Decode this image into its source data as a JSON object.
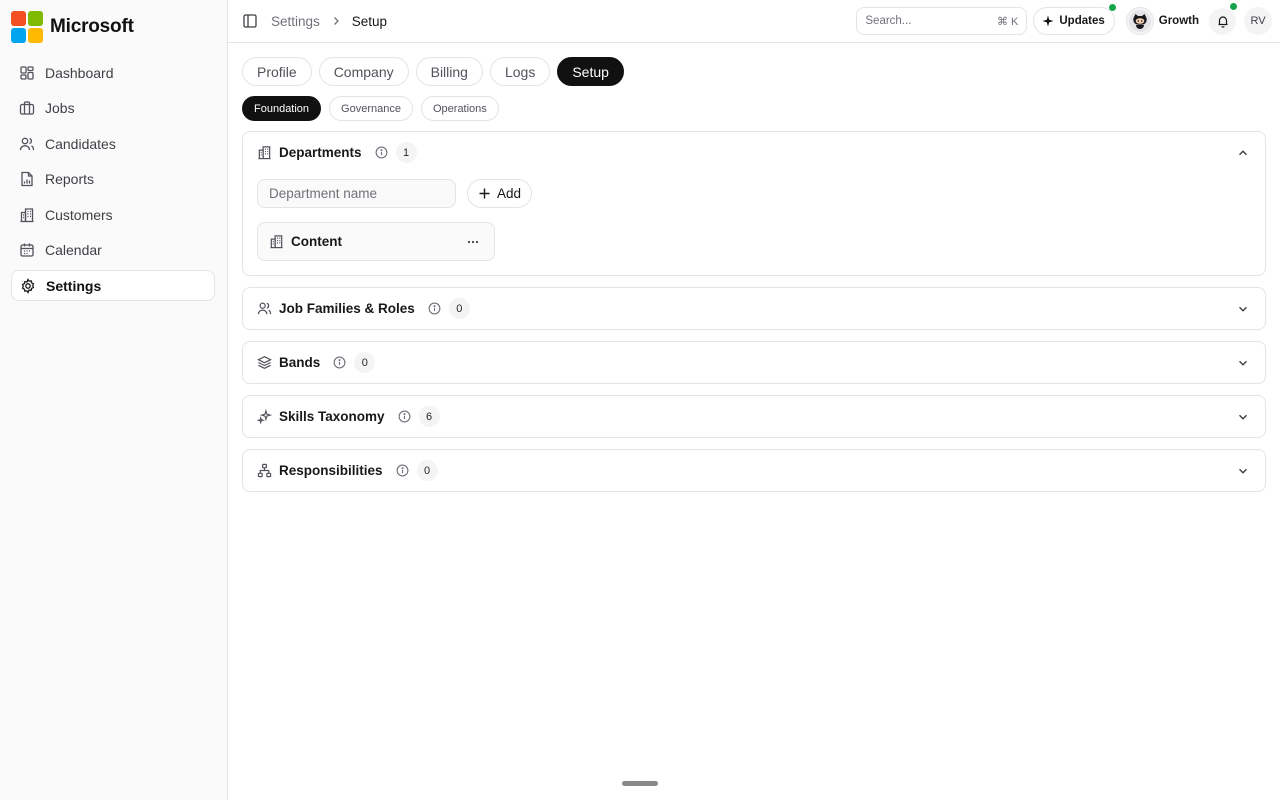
{
  "brand": {
    "name": "Microsoft",
    "logo_colors": [
      "#f25022",
      "#7fba00",
      "#00a4ef",
      "#ffb900"
    ]
  },
  "sidebar": {
    "items": [
      {
        "label": "Dashboard",
        "icon": "dashboard-icon",
        "active": false
      },
      {
        "label": "Jobs",
        "icon": "briefcase-icon",
        "active": false
      },
      {
        "label": "Candidates",
        "icon": "users-icon",
        "active": false
      },
      {
        "label": "Reports",
        "icon": "report-icon",
        "active": false
      },
      {
        "label": "Customers",
        "icon": "building-icon",
        "active": false
      },
      {
        "label": "Calendar",
        "icon": "calendar-icon",
        "active": false
      },
      {
        "label": "Settings",
        "icon": "gear-icon",
        "active": true
      }
    ]
  },
  "topbar": {
    "breadcrumb": [
      "Settings",
      "Setup"
    ],
    "search": {
      "placeholder": "Search...",
      "shortcut": "⌘ K"
    },
    "updates_label": "Updates",
    "workspace_label": "Growth",
    "user_initials": "RV",
    "status_color": "#16a34a"
  },
  "tabs": [
    {
      "label": "Profile",
      "active": false
    },
    {
      "label": "Company",
      "active": false
    },
    {
      "label": "Billing",
      "active": false
    },
    {
      "label": "Logs",
      "active": false
    },
    {
      "label": "Setup",
      "active": true
    }
  ],
  "subtabs": [
    {
      "label": "Foundation",
      "active": true
    },
    {
      "label": "Governance",
      "active": false
    },
    {
      "label": "Operations",
      "active": false
    }
  ],
  "sections": [
    {
      "title": "Departments",
      "count": "1",
      "expanded": true,
      "icon": "building-icon",
      "input_placeholder": "Department name",
      "add_label": "Add",
      "items": [
        {
          "name": "Content"
        }
      ]
    },
    {
      "title": "Job Families & Roles",
      "count": "0",
      "expanded": false,
      "icon": "users-icon"
    },
    {
      "title": "Bands",
      "count": "0",
      "expanded": false,
      "icon": "layers-icon"
    },
    {
      "title": "Skills Taxonomy",
      "count": "6",
      "expanded": false,
      "icon": "sparkles-icon"
    },
    {
      "title": "Responsibilities",
      "count": "0",
      "expanded": false,
      "icon": "hierarchy-icon"
    }
  ]
}
